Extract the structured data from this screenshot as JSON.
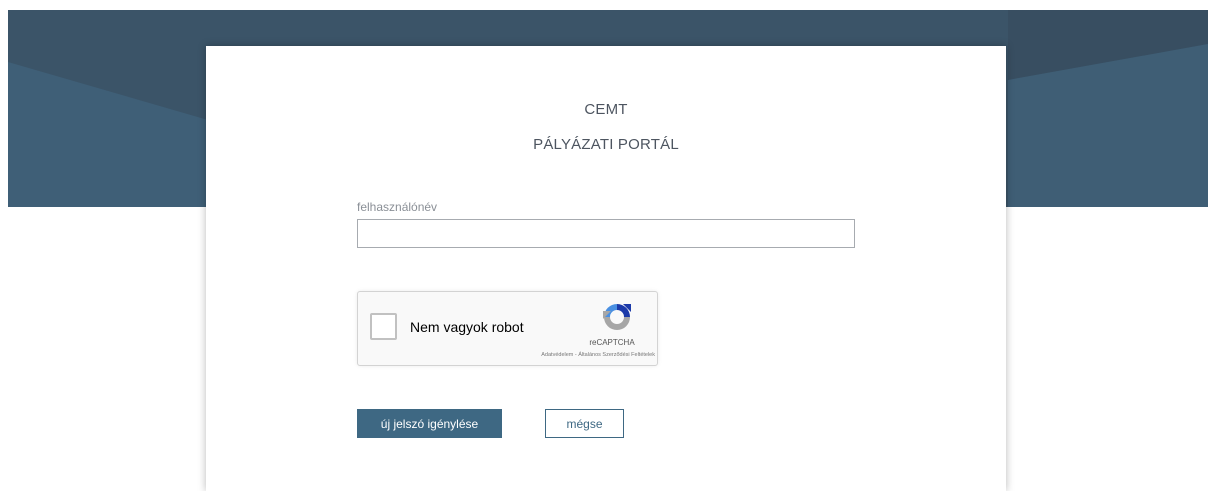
{
  "header": {
    "app_name": "CEMT",
    "portal_name": "PÁLYÁZATI PORTÁL"
  },
  "form": {
    "username_label": "felhasználónév",
    "username_value": "",
    "username_placeholder": ""
  },
  "recaptcha": {
    "checkbox_label": "Nem vagyok robot",
    "checked": false,
    "brand": "reCAPTCHA",
    "links": "Adatvédelem - Általános Szerződési Feltételek",
    "icon": "recaptcha-logo-icon"
  },
  "actions": {
    "submit_label": "új jelszó igénylése",
    "cancel_label": "mégse"
  },
  "colors": {
    "header_dark": "#3d5569",
    "header_light": "#42637a",
    "primary": "#3e6883",
    "captcha_blue": "#1c3aa9",
    "captcha_light_blue": "#4a90e2",
    "captcha_gray": "#a6a6a6"
  }
}
